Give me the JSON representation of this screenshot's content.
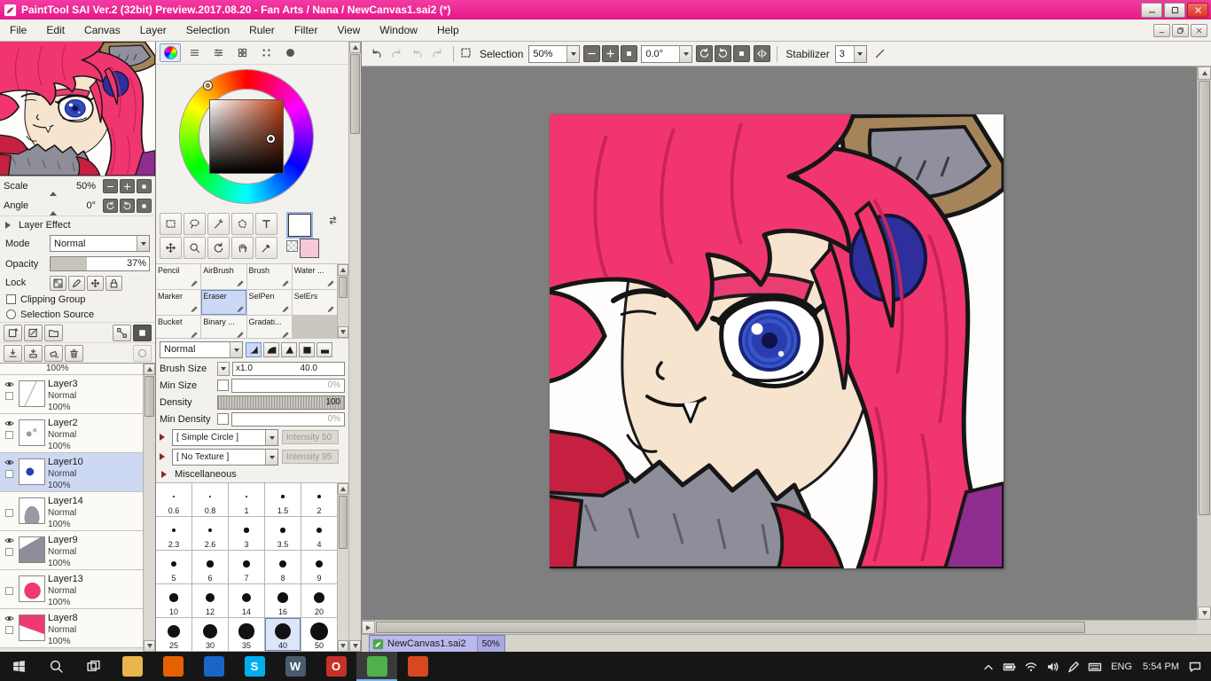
{
  "window": {
    "title": "PaintTool SAI Ver.2 (32bit) Preview.2017.08.20 - Fan Arts / Nana / NewCanvas1.sai2 (*)"
  },
  "menu_bar": {
    "items": [
      "File",
      "Edit",
      "Canvas",
      "Layer",
      "Selection",
      "Ruler",
      "Filter",
      "View",
      "Window",
      "Help"
    ]
  },
  "top_toolbar": {
    "history_buttons": [
      {
        "icon": "undo",
        "enabled": true
      },
      {
        "icon": "redo",
        "enabled": false
      },
      {
        "icon": "undo-alt",
        "enabled": false
      },
      {
        "icon": "redo-alt",
        "enabled": false
      }
    ],
    "selection_label": "Selection",
    "zoom_value": "50%",
    "zoom_buttons": [
      "zoom-out",
      "zoom-in",
      "zoom-reset"
    ],
    "angle_value": "0.0°",
    "rotate_buttons": [
      "rotate-ccw",
      "rotate-cw",
      "rotate-reset"
    ],
    "flip_button": "flip-horizontal",
    "stabilizer_label": "Stabilizer",
    "stabilizer_value": "3",
    "stabilizer_line_button": "stabilizer-line"
  },
  "navigator": {
    "scale_label": "Scale",
    "scale_value": "50%",
    "scale_buttons": [
      "zoom-out",
      "zoom-in",
      "zoom-reset"
    ],
    "angle_label": "Angle",
    "angle_value": "0°",
    "angle_buttons": [
      "rotate-ccw",
      "rotate-cw",
      "rotate-reset"
    ]
  },
  "layer_panel": {
    "effect_header": "Layer Effect",
    "mode_label": "Mode",
    "mode_value": "Normal",
    "opacity_label": "Opacity",
    "opacity_value": "37%",
    "opacity_percent": 37,
    "lock_label": "Lock",
    "lock_buttons": [
      "lock-alpha",
      "lock-pen",
      "lock-move",
      "lock-all"
    ],
    "clipping_group_label": "Clipping Group",
    "selection_source_label": "Selection Source",
    "toolbar_row1": [
      "new-layer",
      "new-linework-layer",
      "new-folder",
      "spacer",
      "transform",
      "special-mode"
    ],
    "toolbar_row2": [
      "transfer-down",
      "merge-down",
      "clear-layer",
      "delete-layer",
      "spacer",
      "layer-mask"
    ],
    "partial_row_opacity": "100%",
    "layers": [
      {
        "name": "Layer3",
        "mode": "Normal",
        "opacity": "100%",
        "visible": true,
        "selected": false,
        "thumb": "sketch"
      },
      {
        "name": "Layer2",
        "mode": "Normal",
        "opacity": "100%",
        "visible": true,
        "selected": false,
        "thumb": "dots"
      },
      {
        "name": "Layer10",
        "mode": "Normal",
        "opacity": "100%",
        "visible": true,
        "selected": true,
        "thumb": "blue-dot"
      },
      {
        "name": "Layer14",
        "mode": "Normal",
        "opacity": "100%",
        "visible": false,
        "selected": false,
        "thumb": "gray-smudge"
      },
      {
        "name": "Layer9",
        "mode": "Normal",
        "opacity": "100%",
        "visible": true,
        "selected": false,
        "thumb": "gray-fur"
      },
      {
        "name": "Layer13",
        "mode": "Normal",
        "opacity": "100%",
        "visible": false,
        "selected": false,
        "thumb": "pink-swirl"
      },
      {
        "name": "Layer8",
        "mode": "Normal",
        "opacity": "100%",
        "visible": true,
        "selected": false,
        "thumb": "pink-hair"
      }
    ]
  },
  "color_panel": {
    "tabs": [
      "color-wheel",
      "color-bars",
      "color-sliders",
      "swatch-grid",
      "swatch-dots",
      "color-mixer"
    ],
    "primary_color": "#ffffff",
    "secondary_color": "#f8c8d8",
    "selected_hue_color": "#b03a18"
  },
  "quick_tools": [
    "rect-select",
    "lasso",
    "magic-wand",
    "poly-select",
    "text-tool",
    "move-tool",
    "zoom-tool",
    "rotate-tool",
    "hand-tool",
    "eyedropper-tool"
  ],
  "tool_panel": {
    "tools": [
      "Pencil",
      "AirBrush",
      "Brush",
      "Water ...",
      "Marker",
      "Eraser",
      "SelPen",
      "SelErs",
      "Bucket",
      "Binary ...",
      "Gradati..."
    ],
    "selected_tool": "Eraser"
  },
  "brush_panel": {
    "blend_mode": "Normal",
    "tip_shapes": [
      "tip-soft",
      "tip-dome",
      "tip-hard",
      "tip-block",
      "tip-flat"
    ],
    "tip_selected": 0,
    "size_label": "Brush Size",
    "size_multiplier": "x1.0",
    "size_value": "40.0",
    "min_size_label": "Min Size",
    "min_size_value": "0%",
    "density_label": "Density",
    "density_value": "100",
    "min_density_label": "Min Density",
    "min_density_value": "0%",
    "shape_select": "[ Simple Circle ]",
    "shape_intensity": "Intensity 50",
    "texture_select": "[ No Texture ]",
    "texture_intensity": "Intensity 95",
    "misc_header": "Miscellaneous"
  },
  "size_grid": {
    "values": [
      "0.6",
      "0.8",
      "1",
      "1.5",
      "2",
      "2.3",
      "2.6",
      "3",
      "3.5",
      "4",
      "5",
      "6",
      "7",
      "8",
      "9",
      "10",
      "12",
      "14",
      "16",
      "20",
      "25",
      "30",
      "35",
      "40",
      "50"
    ],
    "selected": "40"
  },
  "document": {
    "tab_name": "NewCanvas1.sai2",
    "tab_zoom": "50%"
  },
  "taskbar": {
    "language": "ENG",
    "time": "5:54 PM",
    "apps": [
      {
        "name": "file-explorer",
        "glyph": "",
        "color": "#e8b64c",
        "active": false
      },
      {
        "name": "firefox",
        "glyph": "",
        "color": "#e66000",
        "active": false
      },
      {
        "name": "photos",
        "glyph": "",
        "color": "#1a66c8",
        "active": false
      },
      {
        "name": "skype",
        "glyph": "S",
        "color": "#00aff0",
        "active": false
      },
      {
        "name": "wordpress",
        "glyph": "W",
        "color": "#4a5b6e",
        "active": false
      },
      {
        "name": "opera",
        "glyph": "O",
        "color": "#c83028",
        "active": false
      },
      {
        "name": "painttool-sai",
        "glyph": "",
        "color": "#50b04a",
        "active": true
      },
      {
        "name": "browser",
        "glyph": "",
        "color": "#d84820",
        "active": false
      }
    ],
    "tray_icons": [
      "chevron-up",
      "battery",
      "wifi",
      "volume",
      "pen",
      "keyboard"
    ]
  },
  "colors": {
    "titlebar": "#e81888",
    "selection_highlight": "#cdd9f2",
    "hair_pink": "#f1366f",
    "canvas_background": "#7f7f7f"
  }
}
